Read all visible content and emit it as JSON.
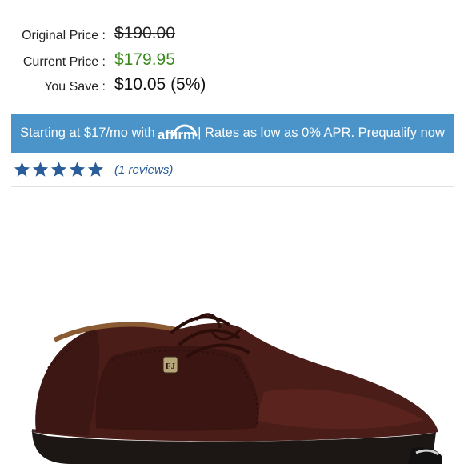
{
  "pricing": {
    "original_label": "Original Price :",
    "original_value": "$190.00",
    "current_label": "Current Price :",
    "current_value": "$179.95",
    "save_label": "You Save :",
    "save_value": "$10.05 (5%)"
  },
  "affirm": {
    "prefix": "Starting at $17/mo with",
    "logo_text": "affirm",
    "suffix": "| Rates as low as 0% APR. Prequalify now"
  },
  "rating": {
    "stars": 5,
    "max_stars": 5,
    "reviews_text": "(1 reviews)"
  },
  "product_image": {
    "subject": "brown leather saddle golf shoe",
    "logo_badge": "FJ"
  },
  "colors": {
    "current_price": "#3a8a1e",
    "banner_bg": "#4b94c9",
    "star": "#2a5d9a",
    "shoe": "#4a1d18"
  }
}
